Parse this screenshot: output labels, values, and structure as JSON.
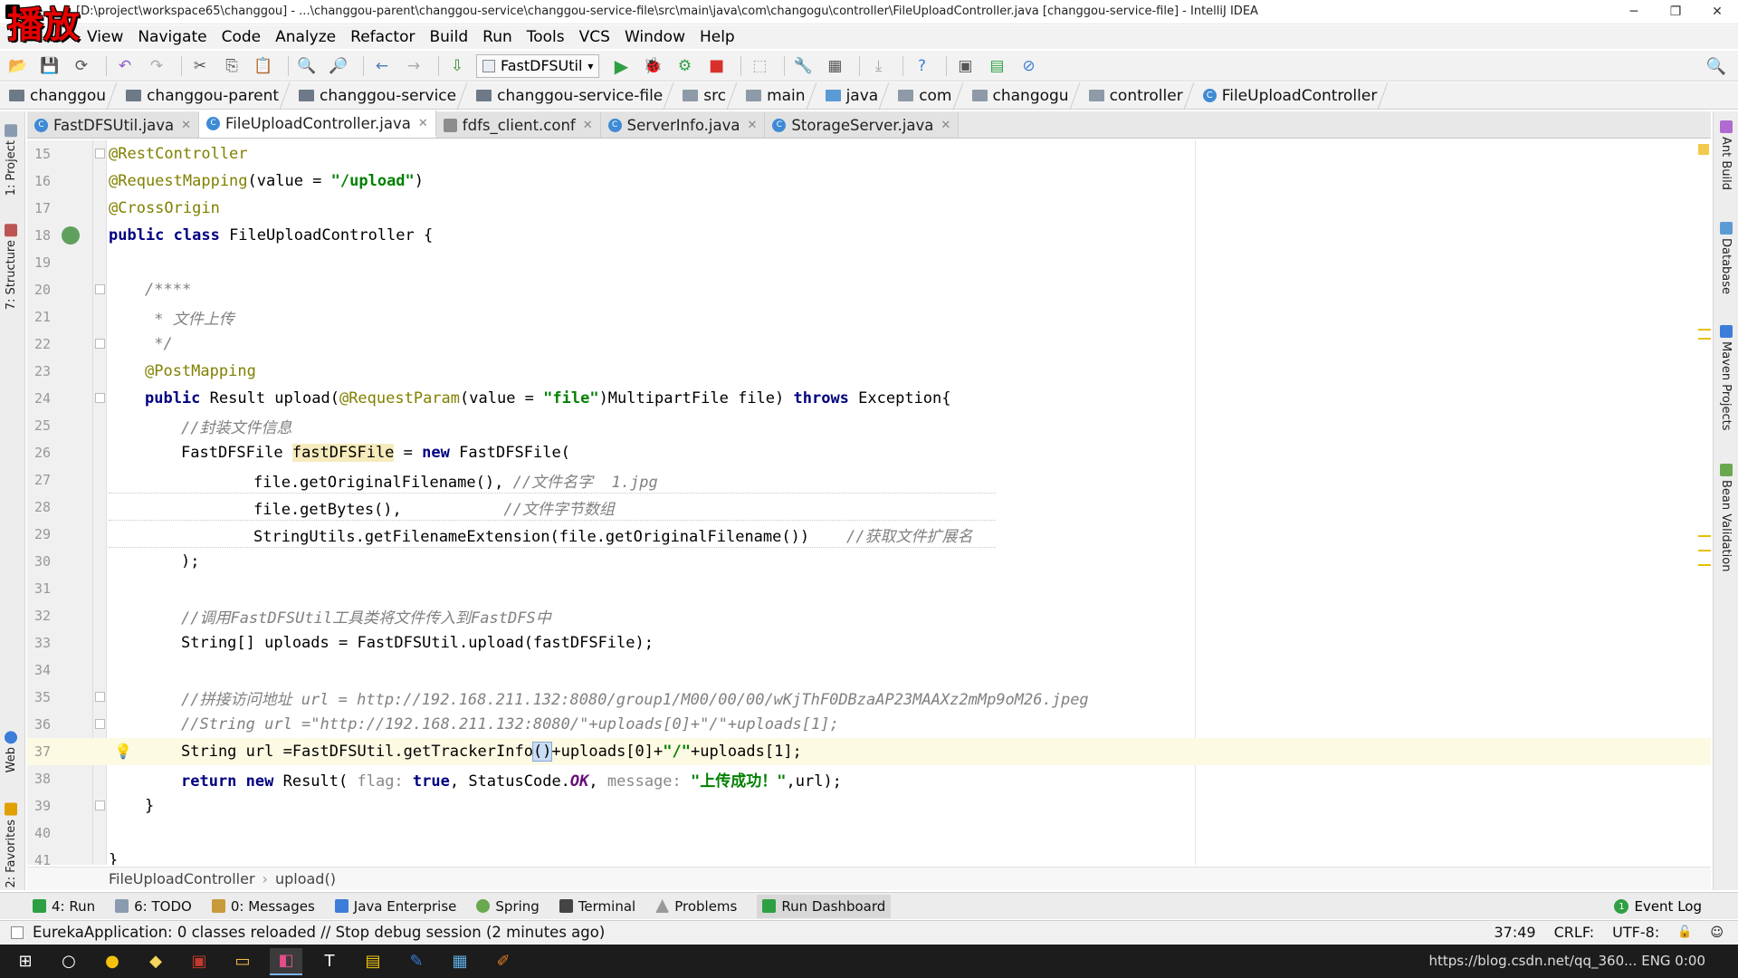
{
  "window": {
    "title": "[D:\\project\\workspace65\\changgou] - ...\\changgou-parent\\changgou-service\\changgou-service-file\\src\\main\\java\\com\\changogu\\controller\\FileUploadController.java [changgou-service-file] - IntelliJ IDEA",
    "overlay_badge": "播放",
    "minimize": "─",
    "restore": "❐",
    "close": "✕"
  },
  "menu": [
    "View",
    "Navigate",
    "Code",
    "Analyze",
    "Refactor",
    "Build",
    "Run",
    "Tools",
    "VCS",
    "Window",
    "Help"
  ],
  "toolbar": {
    "run_config": "FastDFSUtil",
    "dropdown_glyph": "▾"
  },
  "breadcrumb": [
    "changgou",
    "changgou-parent",
    "changgou-service",
    "changgou-service-file",
    "src",
    "main",
    "java",
    "com",
    "changogu",
    "controller",
    "FileUploadController"
  ],
  "tabs": [
    {
      "label": "FastDFSUtil.java",
      "kind": "class"
    },
    {
      "label": "FileUploadController.java",
      "kind": "class",
      "active": true
    },
    {
      "label": "fdfs_client.conf",
      "kind": "file"
    },
    {
      "label": "ServerInfo.java",
      "kind": "class"
    },
    {
      "label": "StorageServer.java",
      "kind": "class"
    }
  ],
  "left_tools": [
    "1: Project",
    "7: Structure",
    "Web",
    "2: Favorites"
  ],
  "right_tools": [
    "Ant Build",
    "Database",
    "Maven Projects",
    "Bean Validation"
  ],
  "editor": {
    "line_numbers": [
      "15",
      "16",
      "17",
      "18",
      "19",
      "20",
      "21",
      "22",
      "23",
      "24",
      "25",
      "26",
      "27",
      "28",
      "29",
      "30",
      "31",
      "32",
      "33",
      "34",
      "35",
      "36",
      "37",
      "38",
      "39",
      "40",
      "41"
    ],
    "current_line": "37",
    "breadcrumb": [
      "FileUploadController",
      "upload()"
    ],
    "code": {
      "l15": "@RestController",
      "l16a": "@RequestMapping",
      "l16b": "(value = ",
      "l16c": "\"/upload\"",
      "l16d": ")",
      "l17": "@CrossOrigin",
      "l18a": "public class ",
      "l18b": "FileUploadController {",
      "l20": "/****",
      "l21": " * 文件上传",
      "l22": " */",
      "l23": "@PostMapping",
      "l24a": "public ",
      "l24b": "Result upload(",
      "l24c": "@RequestParam",
      "l24d": "(value = ",
      "l24e": "\"file\"",
      "l24f": ")MultipartFile file) ",
      "l24g": "throws ",
      "l24h": "Exception{",
      "l25": "//封装文件信息",
      "l26a": "FastDFSFile ",
      "l26b": "fastDFSFile",
      "l26c": " = ",
      "l26d": "new ",
      "l26e": "FastDFSFile(",
      "l27a": "file.getOriginalFilename(), ",
      "l27b": "//文件名字  1.jpg",
      "l28a": "file.getBytes(),           ",
      "l28b": "//文件字节数组",
      "l29a": "StringUtils.getFilenameExtension(file.getOriginalFilename())    ",
      "l29b": "//获取文件扩展名",
      "l30": ");",
      "l32": "//调用FastDFSUtil工具类将文件传入到FastDFS中",
      "l33": "String[] uploads = FastDFSUtil.upload(fastDFSFile);",
      "l35": "//拼接访问地址 url = http://192.168.211.132:8080/group1/M00/00/00/wKjThF0DBzaAP23MAAXz2mMp9oM26.jpeg",
      "l36": "//String url =\"http://192.168.211.132:8080/\"+uploads[0]+\"/\"+uploads[1];",
      "l37a": "String url =FastDFSUtil.getTrackerInfo",
      "l37b": "()",
      "l37c": "+uploads[0]+",
      "l37d": "\"/\"",
      "l37e": "+uploads[1];",
      "l38a": "return new ",
      "l38b": "Result( ",
      "l38c": "flag: ",
      "l38d": "true",
      "l38e": ", StatusCode.",
      "l38f": "OK",
      "l38g": ", ",
      "l38h": "message: ",
      "l38i": "\"上传成功！\"",
      "l38j": ",url);",
      "l39": "}",
      "l41": "}"
    }
  },
  "bottom_tools": [
    {
      "label": "4: Run"
    },
    {
      "label": "6: TODO"
    },
    {
      "label": "0: Messages"
    },
    {
      "label": "Java Enterprise"
    },
    {
      "label": "Spring"
    },
    {
      "label": "Terminal"
    },
    {
      "label": "Problems"
    },
    {
      "label": "Run Dashboard"
    }
  ],
  "event_log": "Event Log",
  "event_log_count": "1",
  "status": {
    "message": "EurekaApplication: 0 classes reloaded // Stop debug session (2 minutes ago)",
    "position": "37:49",
    "line_sep": "CRLF:",
    "encoding": "UTF-8:"
  },
  "taskbar": {
    "watermark": "https://blog.csdn.net/qq_360... ENG 0:00"
  },
  "colors": {
    "annotation": "#808000",
    "keyword": "#000080",
    "string": "#008000",
    "comment": "#808080",
    "current_line": "#fcfae3"
  }
}
